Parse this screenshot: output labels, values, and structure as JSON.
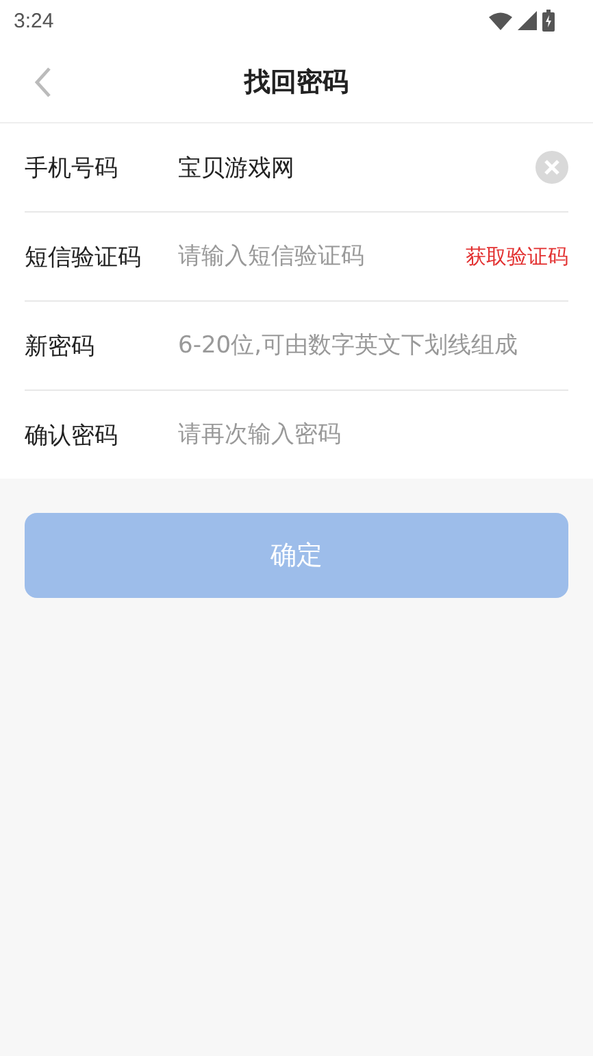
{
  "status_bar": {
    "time": "3:24"
  },
  "header": {
    "title": "找回密码"
  },
  "fields": [
    {
      "label": "手机号码",
      "value": "宝贝游戏网",
      "kind": "clearable"
    },
    {
      "label": "短信验证码",
      "placeholder": "请输入短信验证码",
      "kind": "code",
      "action": "获取验证码"
    },
    {
      "label": "新密码",
      "placeholder": "6-20位,可由数字英文下划线组成",
      "kind": "plain"
    },
    {
      "label": "确认密码",
      "placeholder": "请再次输入密码",
      "kind": "plain"
    }
  ],
  "submit": {
    "label": "确定",
    "disabled": true
  }
}
